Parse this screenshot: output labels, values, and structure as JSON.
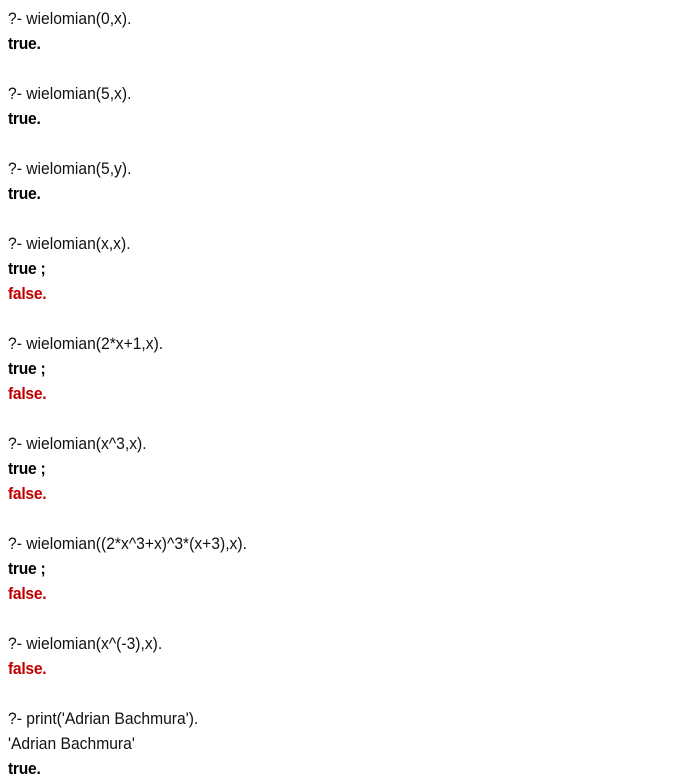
{
  "console": {
    "colors": {
      "true": "#000000",
      "false": "#c00000",
      "text": "#111111"
    },
    "lines": [
      {
        "kind": "query",
        "text": "?- wielomian(0,x)."
      },
      {
        "kind": "true",
        "text": "true."
      },
      {
        "kind": "blank",
        "text": ""
      },
      {
        "kind": "query",
        "text": "?- wielomian(5,x)."
      },
      {
        "kind": "true",
        "text": "true."
      },
      {
        "kind": "blank",
        "text": ""
      },
      {
        "kind": "query",
        "text": "?- wielomian(5,y)."
      },
      {
        "kind": "true",
        "text": "true."
      },
      {
        "kind": "blank",
        "text": ""
      },
      {
        "kind": "query",
        "text": "?- wielomian(x,x)."
      },
      {
        "kind": "true",
        "text": "true ;"
      },
      {
        "kind": "false",
        "text": "false."
      },
      {
        "kind": "blank",
        "text": ""
      },
      {
        "kind": "query",
        "text": "?- wielomian(2*x+1,x)."
      },
      {
        "kind": "true",
        "text": "true ;"
      },
      {
        "kind": "false",
        "text": "false."
      },
      {
        "kind": "blank",
        "text": ""
      },
      {
        "kind": "query",
        "text": "?- wielomian(x^3,x)."
      },
      {
        "kind": "true",
        "text": "true ;"
      },
      {
        "kind": "false",
        "text": "false."
      },
      {
        "kind": "blank",
        "text": ""
      },
      {
        "kind": "query",
        "text": "?- wielomian((2*x^3+x)^3*(x+3),x)."
      },
      {
        "kind": "true",
        "text": "true ;"
      },
      {
        "kind": "false",
        "text": "false."
      },
      {
        "kind": "blank",
        "text": ""
      },
      {
        "kind": "query",
        "text": "?- wielomian(x^(-3),x)."
      },
      {
        "kind": "false",
        "text": "false."
      },
      {
        "kind": "blank",
        "text": ""
      },
      {
        "kind": "query",
        "text": "?- print('Adrian Bachmura')."
      },
      {
        "kind": "output",
        "text": "'Adrian Bachmura'"
      },
      {
        "kind": "true",
        "text": "true."
      }
    ]
  }
}
